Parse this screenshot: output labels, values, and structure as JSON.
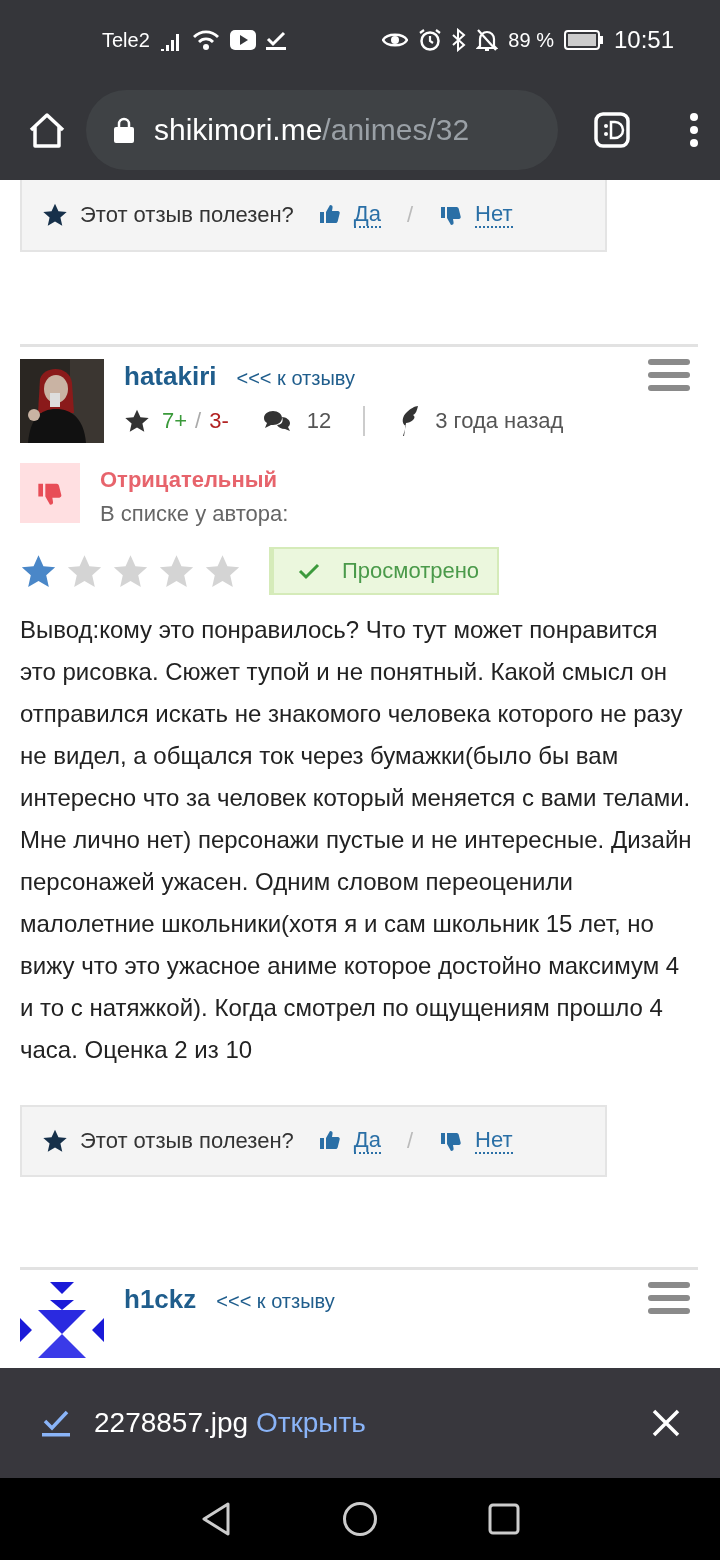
{
  "status_bar": {
    "carrier": "Tele2",
    "battery": "89 %",
    "time": "10:51"
  },
  "browser": {
    "url_host": "shikimori.me",
    "url_path": "/animes/32"
  },
  "top_helpful": {
    "question": "Этот отзыв полезен?",
    "yes": "Да",
    "separator": "/",
    "no": "Нет"
  },
  "reviews": [
    {
      "user": "hatakiri",
      "back_link": "<<< к отзыву",
      "votes_plus": "7+",
      "votes_sep": "/",
      "votes_minus": "3-",
      "comments": "12",
      "time": "3 года назад",
      "sentiment": "Отрицательный",
      "list_label": "В списке у автора:",
      "stars": 1,
      "status": "Просмотрено",
      "text": "Вывод:кому это понравилось? Что тут может понравится это рисовка. Сюжет тупой и не понятный. Какой смысл он отправился искать не знакомого человека которого не разу не видел, а общался ток через бумажки(было бы вам интересно что за человек который меняется с вами телами. Мне лично нет) персонажи пустые и не интересные. Дизайн персонажей ужасен. Одним словом переоценили малолетние школьники(хотя я и сам школьник 15 лет, но вижу что это ужасное аниме которое достойно максимум 4 и то с натяжкой). Когда смотрел по ощущениям прошло 4 часа. Оценка 2 из 10",
      "helpful": {
        "question": "Этот отзыв полезен?",
        "yes": "Да",
        "separator": "/",
        "no": "Нет"
      }
    },
    {
      "kind": "pattern",
      "user": "h1ckz",
      "back_link": "<<< к отзыву"
    }
  ],
  "download": {
    "filename": "2278857.jpg",
    "action": "Открыть"
  }
}
